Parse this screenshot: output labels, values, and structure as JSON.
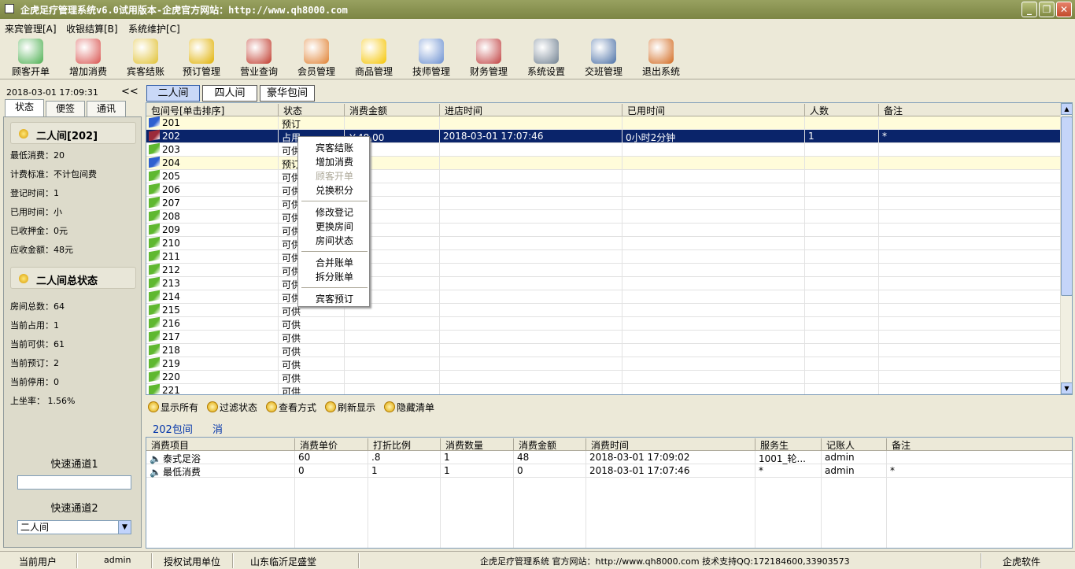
{
  "window": {
    "title": "企虎足疗管理系统v6.0试用版本-企虎官方网站：http://www.qh8000.com",
    "minimize_icon": "minimize-icon",
    "maximize_icon": "maximize-icon",
    "close_icon": "close-icon"
  },
  "menu": {
    "items": [
      "来宾管理[A]",
      "收银结算[B]",
      "系统维护[C]"
    ]
  },
  "toolbar": {
    "buttons": [
      {
        "label": "顾客开单",
        "icon": "customer-icon",
        "color": "#4CAF50"
      },
      {
        "label": "增加消费",
        "icon": "add-consumption-icon",
        "color": "#D9534F"
      },
      {
        "label": "宾客结账",
        "icon": "checkout-icon",
        "color": "#E0C030"
      },
      {
        "label": "预订管理",
        "icon": "alarm-clock-icon",
        "color": "#E0B000"
      },
      {
        "label": "营业查询",
        "icon": "report-icon",
        "color": "#C0392B"
      },
      {
        "label": "会员管理",
        "icon": "members-icon",
        "color": "#E08030"
      },
      {
        "label": "商品管理",
        "icon": "star-icon",
        "color": "#F5C400"
      },
      {
        "label": "技师管理",
        "icon": "technician-icon",
        "color": "#6A8FD0"
      },
      {
        "label": "财务管理",
        "icon": "finance-icon",
        "color": "#C04040"
      },
      {
        "label": "系统设置",
        "icon": "settings-icon",
        "color": "#708090"
      },
      {
        "label": "交班管理",
        "icon": "handshake-icon",
        "color": "#4A6FA5"
      },
      {
        "label": "退出系统",
        "icon": "exit-icon",
        "color": "#D2691E"
      }
    ]
  },
  "left_panel": {
    "datetime": "2018-03-01 17:09:31",
    "collapse": "<<",
    "tabs": [
      "状态",
      "便签",
      "通讯"
    ],
    "room_title": "二人间[202]",
    "room_info": [
      "最低消费：20",
      "计费标准：不计包间费",
      "登记时间：1",
      "已用时间：小",
      "已收押金：0元",
      "应收金额：48元"
    ],
    "total_title": "二人间总状态",
    "total_info": [
      "房间总数：64",
      "当前占用：1",
      "当前可供：61",
      "当前预订：2",
      "当前停用：0",
      "上坐率：  1.56%"
    ],
    "quick1_label": "快速通道1",
    "quick1_value": "",
    "quick2_label": "快速通道2",
    "quick2_value": "二人间"
  },
  "room_tabs": [
    "二人间",
    "四人间",
    "豪华包间"
  ],
  "grid": {
    "headers": [
      "包间号[单击排序]",
      "状态",
      "消费金额",
      "进店时间",
      "已用时间",
      "人数",
      "备注"
    ],
    "rows": [
      {
        "room": "201",
        "status": "预订",
        "amount": "",
        "checkin": "",
        "elapsed": "",
        "people": "",
        "note": "",
        "state": "reserved"
      },
      {
        "room": "202",
        "status": "占用",
        "amount": "￥48.00",
        "checkin": "2018-03-01 17:07:46",
        "elapsed": "0小时2分钟",
        "people": "1",
        "note": "*",
        "state": "selected"
      },
      {
        "room": "203",
        "status": "可供",
        "amount": "",
        "checkin": "",
        "elapsed": "",
        "people": "",
        "note": "",
        "state": "free"
      },
      {
        "room": "204",
        "status": "预订",
        "amount": "",
        "checkin": "",
        "elapsed": "",
        "people": "",
        "note": "",
        "state": "reserved"
      },
      {
        "room": "205",
        "status": "可供",
        "amount": "",
        "checkin": "",
        "elapsed": "",
        "people": "",
        "note": "",
        "state": "free"
      },
      {
        "room": "206",
        "status": "可供",
        "amount": "",
        "checkin": "",
        "elapsed": "",
        "people": "",
        "note": "",
        "state": "free"
      },
      {
        "room": "207",
        "status": "可供",
        "amount": "",
        "checkin": "",
        "elapsed": "",
        "people": "",
        "note": "",
        "state": "free"
      },
      {
        "room": "208",
        "status": "可供",
        "amount": "",
        "checkin": "",
        "elapsed": "",
        "people": "",
        "note": "",
        "state": "free"
      },
      {
        "room": "209",
        "status": "可供",
        "amount": "",
        "checkin": "",
        "elapsed": "",
        "people": "",
        "note": "",
        "state": "free"
      },
      {
        "room": "210",
        "status": "可供",
        "amount": "",
        "checkin": "",
        "elapsed": "",
        "people": "",
        "note": "",
        "state": "free"
      },
      {
        "room": "211",
        "status": "可供",
        "amount": "",
        "checkin": "",
        "elapsed": "",
        "people": "",
        "note": "",
        "state": "free"
      },
      {
        "room": "212",
        "status": "可供",
        "amount": "",
        "checkin": "",
        "elapsed": "",
        "people": "",
        "note": "",
        "state": "free"
      },
      {
        "room": "213",
        "status": "可供",
        "amount": "",
        "checkin": "",
        "elapsed": "",
        "people": "",
        "note": "",
        "state": "free"
      },
      {
        "room": "214",
        "status": "可供",
        "amount": "",
        "checkin": "",
        "elapsed": "",
        "people": "",
        "note": "",
        "state": "free"
      },
      {
        "room": "215",
        "status": "可供",
        "amount": "",
        "checkin": "",
        "elapsed": "",
        "people": "",
        "note": "",
        "state": "free"
      },
      {
        "room": "216",
        "status": "可供",
        "amount": "",
        "checkin": "",
        "elapsed": "",
        "people": "",
        "note": "",
        "state": "free"
      },
      {
        "room": "217",
        "status": "可供",
        "amount": "",
        "checkin": "",
        "elapsed": "",
        "people": "",
        "note": "",
        "state": "free"
      },
      {
        "room": "218",
        "status": "可供",
        "amount": "",
        "checkin": "",
        "elapsed": "",
        "people": "",
        "note": "",
        "state": "free"
      },
      {
        "room": "219",
        "status": "可供",
        "amount": "",
        "checkin": "",
        "elapsed": "",
        "people": "",
        "note": "",
        "state": "free"
      },
      {
        "room": "220",
        "status": "可供",
        "amount": "",
        "checkin": "",
        "elapsed": "",
        "people": "",
        "note": "",
        "state": "free"
      },
      {
        "room": "221",
        "status": "可供",
        "amount": "",
        "checkin": "",
        "elapsed": "",
        "people": "",
        "note": "",
        "state": "free"
      }
    ]
  },
  "context_menu": {
    "items": [
      "宾客结账",
      "增加消费",
      "顾客开单",
      "兑换积分",
      "修改登记",
      "更换房间",
      "房间状态",
      "合并账单",
      "拆分账单",
      "宾客预订"
    ],
    "disabled": [
      "顾客开单"
    ]
  },
  "actions": [
    "显示所有",
    "过滤状态",
    "查看方式",
    "刷新显示",
    "隐藏清单"
  ],
  "detail": {
    "room_label": "202包间",
    "extra_label": "消",
    "headers": [
      "消费项目",
      "消费单价",
      "打折比例",
      "消费数量",
      "消费金额",
      "消费时间",
      "服务生",
      "记账人",
      "备注"
    ],
    "rows": [
      {
        "item": "泰式足浴",
        "price": "60",
        "discount": ".8",
        "qty": "1",
        "amount": "48",
        "time": "2018-03-01 17:09:02",
        "waiter": "1001_轮...",
        "recorder": "admin",
        "note": ""
      },
      {
        "item": "最低消费",
        "price": "0",
        "discount": "1",
        "qty": "1",
        "amount": "0",
        "time": "2018-03-01 17:07:46",
        "waiter": "*",
        "recorder": "admin",
        "note": "*"
      }
    ]
  },
  "statusbar": {
    "user_label": "当前用户",
    "user": "admin",
    "license_label": "授权试用单位",
    "license": "山东临沂足盛堂",
    "center": "企虎足疗管理系统 官方网站：http://www.qh8000.com 技术支持QQ:172184600,33903573",
    "brand": "企虎软件"
  },
  "colors": {
    "title_bar": "#7C8544",
    "selected_row": "#0A246A",
    "reserved_row": "#FFFCDA",
    "free_room_icon": "#5FB830",
    "reserved_room_icon": "#2F5FD0",
    "occupied_room_icon": "#9B2A3A"
  }
}
